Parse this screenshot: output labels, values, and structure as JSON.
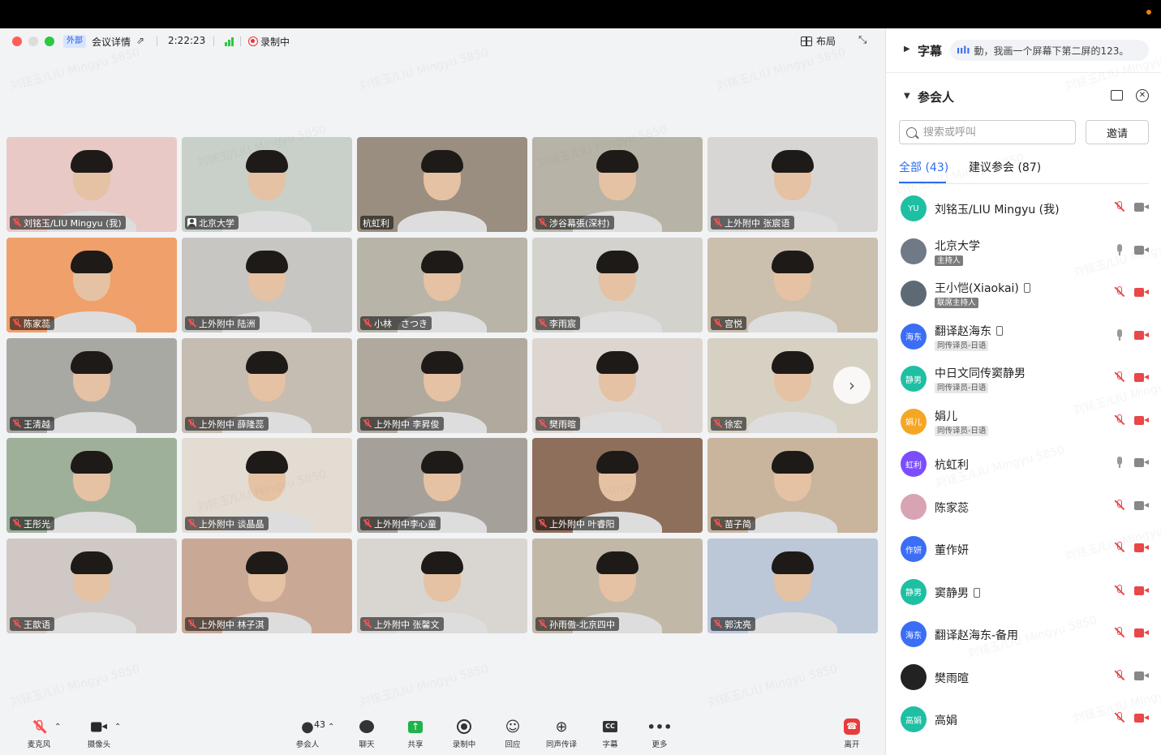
{
  "header": {
    "external_tag": "外部",
    "meeting_detail": "会议详情",
    "timer": "2:22:23",
    "recording": "录制中",
    "layout": "布局"
  },
  "watermark": "刘铭玉/LIU Mingyu 5850",
  "tiles": [
    {
      "name": "刘铭玉/LIU Mingyu (我)",
      "muted": true,
      "bg": "#e8c9c6"
    },
    {
      "name": "北京大学",
      "muted": false,
      "badge": true,
      "bg": "#c9cfc9"
    },
    {
      "name": "杭虹利",
      "muted": false,
      "bg": "#9a8e80"
    },
    {
      "name": "涉谷幕張(深村)",
      "muted": true,
      "bg": "#b7b3a6"
    },
    {
      "name": "上外附中 张宸语",
      "muted": true,
      "bg": "#d8d6d4"
    },
    {
      "name": "陈家蕊",
      "muted": true,
      "bg": "#f0a06a"
    },
    {
      "name": "上外附中 陆洲",
      "muted": true,
      "bg": "#c8c6c3"
    },
    {
      "name": "小林　さつき",
      "muted": true,
      "bg": "#b8b4a8"
    },
    {
      "name": "李雨宸",
      "muted": true,
      "bg": "#d4d2cc"
    },
    {
      "name": "宫悦",
      "muted": true,
      "bg": "#cbbfae"
    },
    {
      "name": "王清越",
      "muted": true,
      "bg": "#a9a9a4"
    },
    {
      "name": "上外附中 薛隆蕊",
      "muted": true,
      "bg": "#c5bcb2"
    },
    {
      "name": "上外附中 李昇俊",
      "muted": true,
      "bg": "#b0a99d"
    },
    {
      "name": "樊雨暄",
      "muted": true,
      "bg": "#ddd6d0"
    },
    {
      "name": "徐宏",
      "muted": true,
      "bg": "#d7d1c4"
    },
    {
      "name": "王彤光",
      "muted": true,
      "bg": "#9fb09a"
    },
    {
      "name": "上外附中 谈晶晶",
      "muted": true,
      "bg": "#e3dcd2"
    },
    {
      "name": "上外附中李心童",
      "muted": true,
      "bg": "#a6a09a"
    },
    {
      "name": "上外附中 叶睿阳",
      "muted": true,
      "bg": "#8e6f5b"
    },
    {
      "name": "苗子简",
      "muted": true,
      "bg": "#c9b59e"
    },
    {
      "name": "王歆语",
      "muted": true,
      "bg": "#cfc8c4"
    },
    {
      "name": "上外附中 林子淇",
      "muted": true,
      "bg": "#c9a996"
    },
    {
      "name": "上外附中 张馨文",
      "muted": true,
      "bg": "#d9d6d2"
    },
    {
      "name": "孙雨傲-北京四中",
      "muted": true,
      "bg": "#c2b8a8"
    },
    {
      "name": "郭沈亮",
      "muted": true,
      "bg": "#bcc7d8"
    }
  ],
  "toolbar": {
    "mic": "麦克风",
    "camera": "摄像头",
    "participants": "参会人",
    "participants_count": "43",
    "chat": "聊天",
    "share": "共享",
    "recording": "录制中",
    "reaction": "回应",
    "interpretation": "同声传译",
    "captions": "字幕",
    "more": "更多",
    "leave": "离开"
  },
  "sidepanel": {
    "caption_title": "字幕",
    "caption_text": "動，我画一个屏幕下第二屏的123。",
    "participants_title": "参会人",
    "search_placeholder": "搜索或呼叫",
    "invite": "邀请",
    "tab_all": "全部 (43)",
    "tab_suggested": "建议参会 (87)",
    "participants": [
      {
        "avatar": "YU",
        "color": "#1fbfa3",
        "name": "刘铭玉/LIU Mingyu (我)",
        "role": "",
        "phone": false,
        "mic": "muted",
        "cam": "on"
      },
      {
        "avatar": "",
        "color": "#6f7a86",
        "name": "北京大学",
        "role": "主持人",
        "host": true,
        "phone": false,
        "mic": "on",
        "cam": "on"
      },
      {
        "avatar": "",
        "color": "#5d6a76",
        "name": "王小恺(Xiaokai)",
        "role": "联席主持人",
        "host": true,
        "phone": true,
        "mic": "muted",
        "cam": "off"
      },
      {
        "avatar": "海东",
        "color": "#3b6ef5",
        "name": "翻译赵海东",
        "role": "同传译员-日语",
        "phone": true,
        "mic": "on",
        "cam": "off"
      },
      {
        "avatar": "静男",
        "color": "#1fbfa3",
        "name": "中日文同传窦静男",
        "role": "同传译员-日语",
        "phone": false,
        "mic": "muted",
        "cam": "off"
      },
      {
        "avatar": "娟儿",
        "color": "#f5a623",
        "name": "娟儿",
        "role": "同传译员-日语",
        "phone": false,
        "mic": "muted",
        "cam": "off"
      },
      {
        "avatar": "虹利",
        "color": "#7b4dff",
        "name": "杭虹利",
        "role": "",
        "phone": false,
        "mic": "on",
        "cam": "on"
      },
      {
        "avatar": "",
        "color": "#d8a4b4",
        "name": "陈家蕊",
        "role": "",
        "phone": false,
        "mic": "muted",
        "cam": "on"
      },
      {
        "avatar": "作妍",
        "color": "#3b6ef5",
        "name": "董作妍",
        "role": "",
        "phone": false,
        "mic": "muted",
        "cam": "off"
      },
      {
        "avatar": "静男",
        "color": "#1fbfa3",
        "name": "窦静男",
        "role": "",
        "phone": true,
        "mic": "muted",
        "cam": "off"
      },
      {
        "avatar": "海东",
        "color": "#3b6ef5",
        "name": "翻译赵海东-备用",
        "role": "",
        "phone": false,
        "mic": "muted",
        "cam": "off"
      },
      {
        "avatar": "",
        "color": "#222222",
        "name": "樊雨暄",
        "role": "",
        "phone": false,
        "mic": "muted",
        "cam": "on"
      },
      {
        "avatar": "高娟",
        "color": "#1fbfa3",
        "name": "高娟",
        "role": "",
        "phone": false,
        "mic": "muted",
        "cam": "off"
      }
    ]
  }
}
